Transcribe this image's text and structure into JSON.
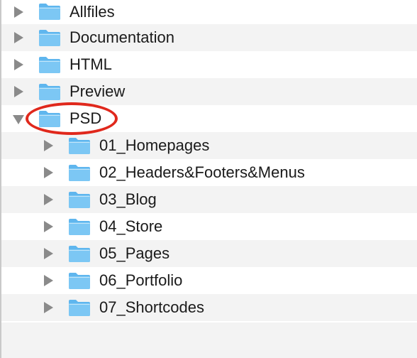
{
  "tree": {
    "top_level": [
      {
        "label": "Allfiles",
        "expanded": false
      },
      {
        "label": "Documentation",
        "expanded": false
      },
      {
        "label": "HTML",
        "expanded": false
      },
      {
        "label": "Preview",
        "expanded": false
      },
      {
        "label": "PSD",
        "expanded": true,
        "highlighted": true
      }
    ],
    "psd_children": [
      {
        "label": "01_Homepages"
      },
      {
        "label": "02_Headers&Footers&Menus"
      },
      {
        "label": "03_Blog"
      },
      {
        "label": "04_Store"
      },
      {
        "label": "05_Pages"
      },
      {
        "label": "06_Portfolio"
      },
      {
        "label": "07_Shortcodes"
      }
    ]
  },
  "colors": {
    "folder_fill": "#7cc7f4",
    "folder_top": "#5fb6ee",
    "disclosure": "#8a8a8a",
    "highlight_ring": "#e0281c",
    "alt_row": "#f3f3f3"
  },
  "icons": {
    "folder": "folder-icon",
    "closed": "disclosure-triangle-closed-icon",
    "open": "disclosure-triangle-open-icon"
  }
}
